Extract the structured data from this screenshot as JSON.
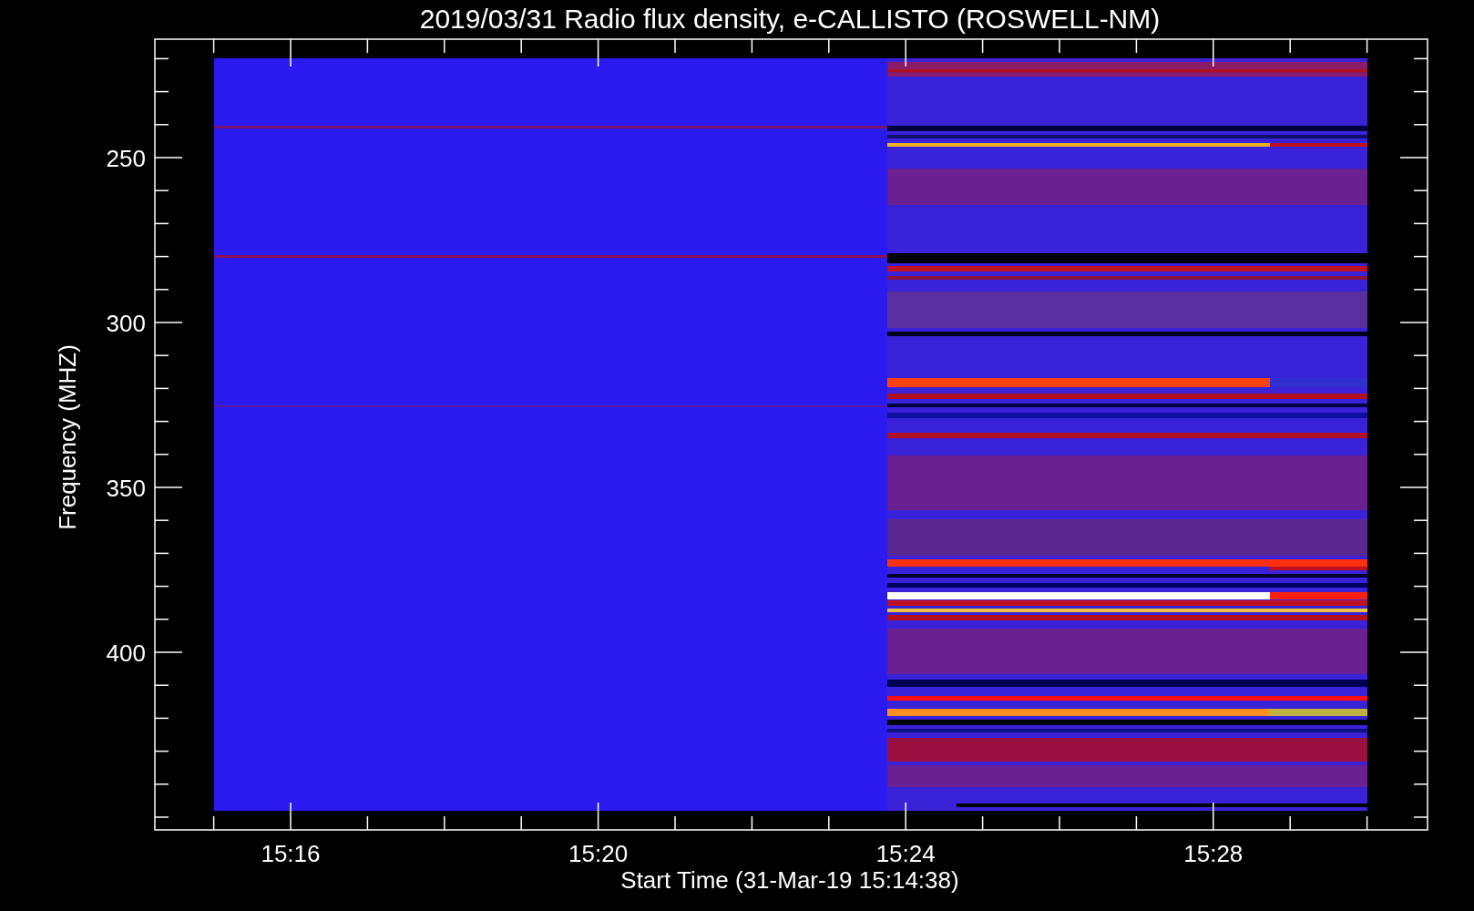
{
  "title": "2019/03/31  Radio flux density, e-CALLISTO (ROSWELL-NM)",
  "axes": {
    "xlabel": "Start Time (31-Mar-19 15:14:38)",
    "ylabel": "Frequency (MHZ)",
    "xticks": [
      "15:16",
      "15:20",
      "15:24",
      "15:28"
    ],
    "yticks": [
      "250",
      "300",
      "350",
      "400"
    ]
  }
}
